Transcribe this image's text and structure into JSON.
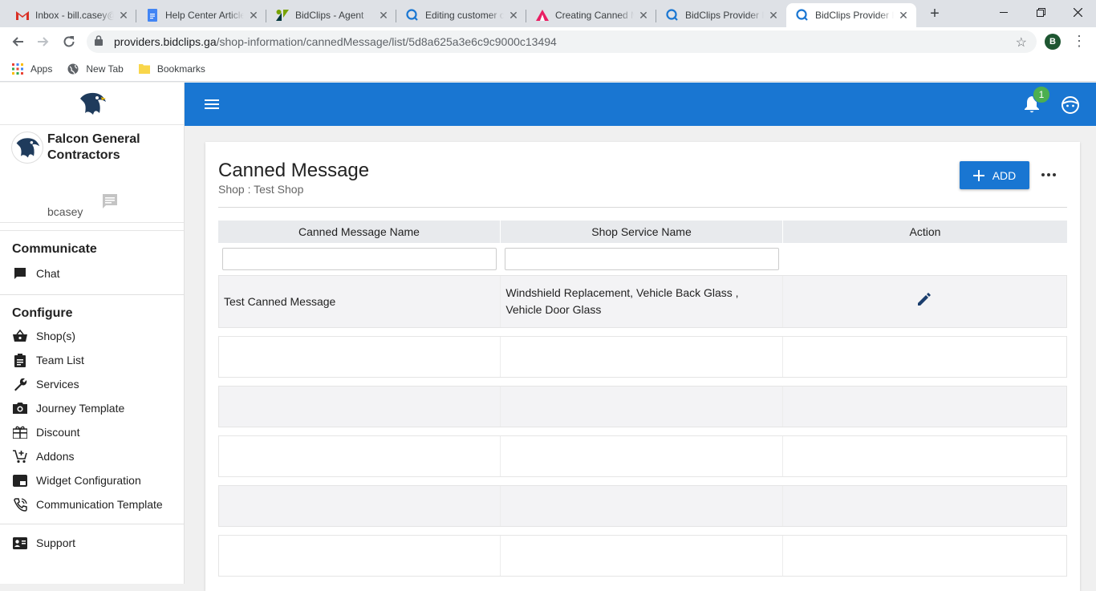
{
  "browser": {
    "tabs": [
      {
        "title": "Inbox - bill.casey@",
        "icon": "gmail-icon"
      },
      {
        "title": "Help Center Article",
        "icon": "docs-icon"
      },
      {
        "title": "BidClips - Agent",
        "icon": "zendesk-icon"
      },
      {
        "title": "Editing customer c",
        "icon": "bidclips-icon"
      },
      {
        "title": "Creating Canned M",
        "icon": "atlas-icon"
      },
      {
        "title": "BidClips Provider P",
        "icon": "bidclips-icon"
      },
      {
        "title": "BidClips Provider P",
        "icon": "bidclips-icon"
      }
    ],
    "url_host": "providers.bidclips.ga",
    "url_path": "/shop-information/cannedMessage/list/5d8a625a3e6c9c9000c13494",
    "profile_initial": "B",
    "bookmarks": [
      {
        "label": "Apps",
        "icon": "apps-grid-icon"
      },
      {
        "label": "New Tab",
        "icon": "globe-icon"
      },
      {
        "label": "Bookmarks",
        "icon": "folder-icon"
      }
    ]
  },
  "sidebar": {
    "company_name": "Falcon General Contractors",
    "username": "bcasey",
    "sections": [
      {
        "heading": "Communicate",
        "items": [
          {
            "label": "Chat",
            "icon": "chat-icon"
          }
        ]
      },
      {
        "heading": "Configure",
        "items": [
          {
            "label": "Shop(s)",
            "icon": "basket-icon"
          },
          {
            "label": "Team List",
            "icon": "clipboard-icon"
          },
          {
            "label": "Services",
            "icon": "wrench-icon"
          },
          {
            "label": "Journey Template",
            "icon": "camera-icon"
          },
          {
            "label": "Discount",
            "icon": "gift-icon"
          },
          {
            "label": "Addons",
            "icon": "cart-plus-icon"
          },
          {
            "label": "Widget Configuration",
            "icon": "widget-icon"
          },
          {
            "label": "Communication Template",
            "icon": "phone-icon"
          }
        ]
      }
    ],
    "support_label": "Support"
  },
  "appbar": {
    "notification_count": "1"
  },
  "page": {
    "title": "Canned Message",
    "subtitle": "Shop : Test Shop",
    "add_label": "ADD",
    "columns": [
      "Canned Message Name",
      "Shop Service Name",
      "Action"
    ],
    "rows": [
      {
        "name": "Test Canned Message",
        "services": "Windshield Replacement, Vehicle Back Glass , Vehicle Door Glass"
      }
    ],
    "empty_rows": 5
  },
  "colors": {
    "primary": "#1976d2",
    "badge": "#4caf50"
  }
}
